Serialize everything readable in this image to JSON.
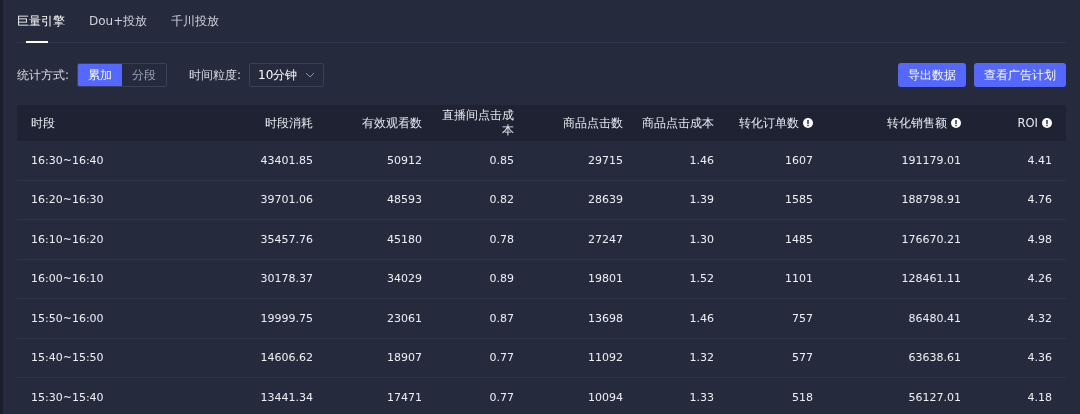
{
  "tabs": [
    {
      "label": "巨量引擎",
      "selected": true
    },
    {
      "label": "Dou+投放",
      "selected": false
    },
    {
      "label": "千川投放",
      "selected": false
    }
  ],
  "toolbar": {
    "mode_label": "统计方式:",
    "modes": [
      {
        "label": "累加",
        "selected": true
      },
      {
        "label": "分段",
        "selected": false
      }
    ],
    "granularity_label": "时间粒度:",
    "granularity": "10分钟",
    "buttons": [
      "导出数据",
      "查看广告计划"
    ]
  },
  "table": {
    "columns": [
      {
        "label": "时段",
        "kind": "plain"
      },
      {
        "label": "时段消耗",
        "kind": "plain"
      },
      {
        "label": "有效观看数",
        "kind": "plain"
      },
      {
        "label": "直播间点击成本",
        "kind": "plain"
      },
      {
        "label": "商品点击数",
        "kind": "plain"
      },
      {
        "label": "商品点击成本",
        "kind": "plain"
      },
      {
        "label": "转化订单数",
        "kind": "info"
      },
      {
        "label": "转化销售额",
        "kind": "info"
      },
      {
        "label": "ROI",
        "kind": "info"
      }
    ],
    "rows": [
      [
        "16:30~16:40",
        "43401.85",
        "50912",
        "0.85",
        "29715",
        "1.46",
        "1607",
        "191179.01",
        "4.41"
      ],
      [
        "16:20~16:30",
        "39701.06",
        "48593",
        "0.82",
        "28639",
        "1.39",
        "1585",
        "188798.91",
        "4.76"
      ],
      [
        "16:10~16:20",
        "35457.76",
        "45180",
        "0.78",
        "27247",
        "1.30",
        "1485",
        "176670.21",
        "4.98"
      ],
      [
        "16:00~16:10",
        "30178.37",
        "34029",
        "0.89",
        "19801",
        "1.52",
        "1101",
        "128461.11",
        "4.26"
      ],
      [
        "15:50~16:00",
        "19999.75",
        "23061",
        "0.87",
        "13698",
        "1.46",
        "757",
        "86480.41",
        "4.32"
      ],
      [
        "15:40~15:50",
        "14606.62",
        "18907",
        "0.77",
        "11092",
        "1.32",
        "577",
        "63638.61",
        "4.36"
      ],
      [
        "15:30~15:40",
        "13441.34",
        "17471",
        "0.77",
        "10094",
        "1.33",
        "518",
        "56127.01",
        "4.18"
      ]
    ]
  }
}
